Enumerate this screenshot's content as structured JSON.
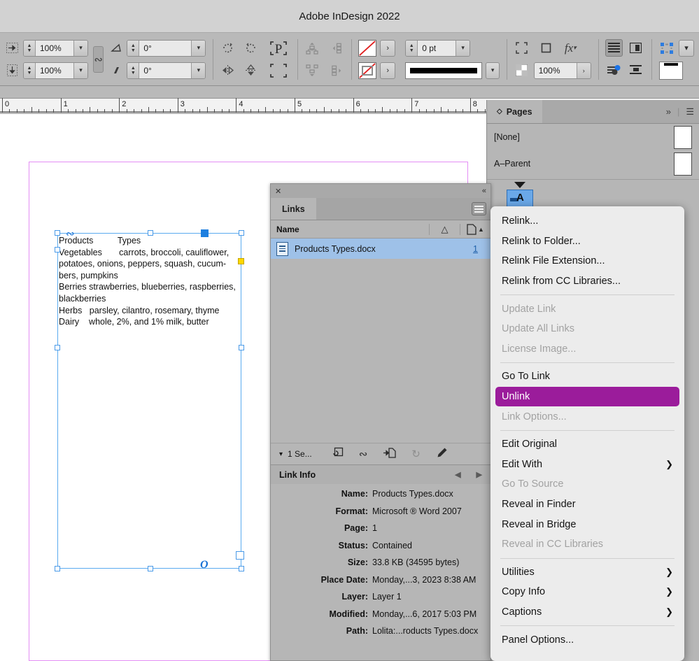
{
  "app": {
    "title": "Adobe InDesign 2022"
  },
  "control_bar": {
    "scale_x": {
      "icon": "scale-horizontal-icon",
      "value": "100%"
    },
    "scale_y": {
      "icon": "scale-vertical-icon",
      "value": "100%"
    },
    "constrain_icon": "chain-link-icon",
    "rotation": {
      "icon": "rotation-angle-icon",
      "value": "0°"
    },
    "shear": {
      "icon": "shear-angle-icon",
      "value": "0°"
    },
    "rotate_cw_icon": "rotate-clockwise-icon",
    "rotate_ccw_icon": "rotate-counterclockwise-icon",
    "flip_h_icon": "flip-horizontal-icon",
    "flip_v_icon": "flip-vertical-icon",
    "select_container_icon": "select-container-icon",
    "select_content_icon": "select-content-icon",
    "bring_forward_icon": "bring-forward-icon",
    "bring_front_icon": "bring-to-front-icon",
    "send_backward_icon": "send-backward-icon",
    "send_back_icon": "send-to-back-icon",
    "fill": {
      "icon": "fill-swatch-none-icon",
      "value": "None"
    },
    "stroke": {
      "icon": "stroke-swatch-none-icon",
      "value": "None"
    },
    "stroke_weight": {
      "value": "0 pt"
    },
    "stroke_type": {
      "value": "solid-line"
    },
    "corner_options_icon": "corner-options-icon",
    "object_frame_icon": "object-frame-icon",
    "effects_icon": "fx-effects-icon",
    "opacity": {
      "icon": "transparency-icon",
      "value": "100%"
    },
    "text_wrap_icon": "text-wrap-icon",
    "text_frame_options_icon": "text-frame-options-icon",
    "anchor_icon": "anchored-object-icon",
    "align_icon": "align-objects-icon",
    "distribute_icon": "distribute-objects-icon"
  },
  "ruler": {
    "unit": "inches",
    "labels": [
      "0",
      "1",
      "2",
      "3",
      "4",
      "5",
      "6",
      "7",
      "8"
    ]
  },
  "document": {
    "text_frame": {
      "lines": [
        "Products          Types",
        "Vegetables       carrots, broccoli, cauliflower,",
        "potatoes, onions, peppers, squash, cucum-",
        "bers, pumpkins",
        "Berries strawberries, blueberries, raspberries,",
        "blackberries",
        "Herbs   parsley, cilantro, rosemary, thyme",
        "Dairy    whole, 2%, and 1% milk, butter"
      ]
    }
  },
  "pages_panel": {
    "tab_label": "Pages",
    "expand_icon": "chevron-double-right-icon",
    "menu_icon": "panel-menu-icon",
    "parents": [
      {
        "label": "[None]"
      },
      {
        "label": "A–Parent"
      }
    ],
    "page_thumb_label": "A"
  },
  "links_panel": {
    "close_icon": "close-icon",
    "collapse_icon": "collapse-icon",
    "tab_label": "Links",
    "menu_icon": "panel-menu-icon",
    "columns": {
      "name": "Name",
      "status_icon": "warning-triangle-icon",
      "page_icon": "page-sort-icon",
      "sort_icon": "sort-ascending-icon"
    },
    "rows": [
      {
        "icon": "docx-file-icon",
        "name": "Products Types.docx",
        "page": "1"
      }
    ],
    "toolbar": {
      "expand_icon": "chevron-down-icon",
      "selection_label": "1 Se...",
      "icons": [
        {
          "name": "relink-icon",
          "disabled": false
        },
        {
          "name": "go-to-link-icon",
          "disabled": false
        },
        {
          "name": "relink-from-file-icon",
          "disabled": false
        },
        {
          "name": "update-link-icon",
          "disabled": true
        },
        {
          "name": "edit-original-pencil-icon",
          "disabled": false
        }
      ]
    },
    "link_info": {
      "header": "Link Info",
      "prev_icon": "triangle-left-icon",
      "next_icon": "triangle-right-icon",
      "rows": [
        {
          "label": "Name:",
          "value": "Products Types.docx"
        },
        {
          "label": "Format:",
          "value": "Microsoft ® Word 2007"
        },
        {
          "label": "Page:",
          "value": "1"
        },
        {
          "label": "Status:",
          "value": "Contained"
        },
        {
          "label": "Size:",
          "value": "33.8 KB (34595 bytes)"
        },
        {
          "label": "Place Date:",
          "value": "Monday,...3, 2023 8:38 AM"
        },
        {
          "label": "Layer:",
          "value": "Layer 1"
        },
        {
          "label": "Modified:",
          "value": "Monday,...6, 2017 5:03 PM"
        },
        {
          "label": "Path:",
          "value": "Lolita:...roducts Types.docx"
        }
      ]
    }
  },
  "context_menu": {
    "items": [
      {
        "label": "Relink...",
        "state": "normal",
        "submenu": false
      },
      {
        "label": "Relink to Folder...",
        "state": "normal",
        "submenu": false
      },
      {
        "label": "Relink File Extension...",
        "state": "normal",
        "submenu": false
      },
      {
        "label": "Relink from CC Libraries...",
        "state": "normal",
        "submenu": false
      },
      {
        "divider": true
      },
      {
        "label": "Update Link",
        "state": "disabled",
        "submenu": false
      },
      {
        "label": "Update All Links",
        "state": "disabled",
        "submenu": false
      },
      {
        "label": "License Image...",
        "state": "disabled",
        "submenu": false
      },
      {
        "divider": true
      },
      {
        "label": "Go To Link",
        "state": "normal",
        "submenu": false
      },
      {
        "label": "Unlink",
        "state": "selected",
        "submenu": false
      },
      {
        "label": "Link Options...",
        "state": "disabled",
        "submenu": false
      },
      {
        "divider": true
      },
      {
        "label": "Edit Original",
        "state": "normal",
        "submenu": false
      },
      {
        "label": "Edit With",
        "state": "normal",
        "submenu": true
      },
      {
        "label": "Go To Source",
        "state": "disabled",
        "submenu": false
      },
      {
        "label": "Reveal in Finder",
        "state": "normal",
        "submenu": false
      },
      {
        "label": "Reveal in Bridge",
        "state": "normal",
        "submenu": false
      },
      {
        "label": "Reveal in CC Libraries",
        "state": "disabled",
        "submenu": false
      },
      {
        "divider": true
      },
      {
        "label": "Utilities",
        "state": "normal",
        "submenu": true
      },
      {
        "label": "Copy Info",
        "state": "normal",
        "submenu": true
      },
      {
        "label": "Captions",
        "state": "normal",
        "submenu": true
      },
      {
        "divider": true
      },
      {
        "label": "Panel Options...",
        "state": "normal",
        "submenu": false
      }
    ],
    "submenu_icon": "chevron-right-icon",
    "highlight_color": "#9b1c9b"
  },
  "colors": {
    "chrome": "#b6b6b6",
    "titlebar": "#d2d2d2",
    "selection_blue": "#5aabf0",
    "link_row_blue": "#9ec1e8",
    "margin_guide": "#e48ef5",
    "menu_highlight": "#9b1c9b"
  }
}
